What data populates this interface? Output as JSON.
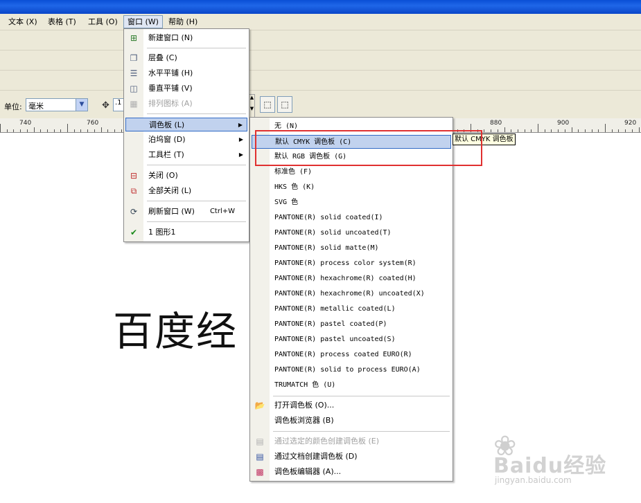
{
  "menubar": {
    "items": [
      "文本 (X)",
      "表格 (T)",
      "工具 (O)",
      "窗口 (W)",
      "帮助 (H)"
    ]
  },
  "propbar": {
    "unit_label": "单位:",
    "unit_value": "毫米",
    "nudge_value": ".1"
  },
  "ruler": {
    "labels": [
      "740",
      "760",
      "880",
      "900",
      "920"
    ]
  },
  "canvas": {
    "text": "百度经"
  },
  "window_menu": {
    "new_window": "新建窗口 (N)",
    "cascade": "层叠 (C)",
    "tile_horizontal": "水平平铺 (H)",
    "tile_vertical": "垂直平铺 (V)",
    "arrange_icons": "排列图标 (A)",
    "color_palettes": "调色板 (L)",
    "dockers": "泊坞窗 (D)",
    "toolbars": "工具栏 (T)",
    "close": "关闭 (O)",
    "close_all": "全部关闭 (L)",
    "refresh": "刷新窗口 (W)",
    "refresh_shortcut": "Ctrl+W",
    "document": "1 图形1"
  },
  "palette_menu": {
    "items": [
      "无 (N)",
      "默认 CMYK 调色板 (C)",
      "默认 RGB 调色板 (G)",
      "标准色 (F)",
      "HKS 色 (K)",
      "SVG 色",
      "PANTONE(R) solid coated(I)",
      "PANTONE(R) solid uncoated(T)",
      "PANTONE(R) solid matte(M)",
      "PANTONE(R) process color system(R)",
      "PANTONE(R) hexachrome(R) coated(H)",
      "PANTONE(R) hexachrome(R) uncoated(X)",
      "PANTONE(R) metallic coated(L)",
      "PANTONE(R) pastel coated(P)",
      "PANTONE(R) pastel uncoated(S)",
      "PANTONE(R) process coated EURO(R)",
      "PANTONE(R) solid to process EURO(A)",
      "TRUMATCH 色 (U)"
    ],
    "open_palette": "打开调色板 (O)...",
    "palette_browser": "调色板浏览器 (B)",
    "create_from_selection": "通过选定的颜色创建调色板 (E)",
    "create_from_document": "通过文档创建调色板 (D)",
    "palette_editor": "调色板编辑器 (A)..."
  },
  "tooltip": "默认 CMYK 调色板",
  "watermark": {
    "brand": "Baidu经验",
    "site": "jingyan.baidu.com"
  },
  "colors": {
    "highlight": "#c1d2ee",
    "highlight_border": "#316ac5",
    "annotation_red": "#e03030",
    "titlebar_blue": "#0a4fd6"
  }
}
